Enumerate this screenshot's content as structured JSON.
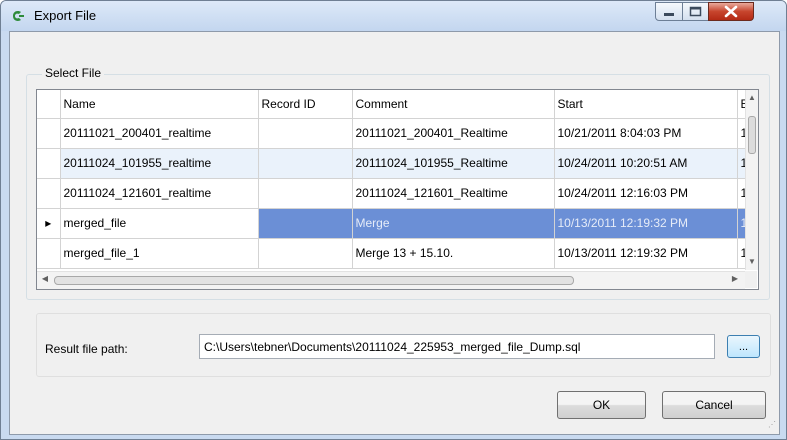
{
  "window": {
    "title": "Export File",
    "app_icon": "export-app-icon",
    "controls": {
      "minimize": "minimize-icon",
      "maximize": "maximize-icon",
      "close": "close-icon"
    }
  },
  "select_file": {
    "label": "Select File",
    "columns": [
      "Name",
      "Record ID",
      "Comment",
      "Start",
      "E"
    ],
    "rows": [
      {
        "name": "20111021_200401_realtime",
        "record_id": "",
        "comment": "20111021_200401_Realtime",
        "start": "10/21/2011 8:04:03 PM",
        "end": "1"
      },
      {
        "name": "20111024_101955_realtime",
        "record_id": "",
        "comment": "20111024_101955_Realtime",
        "start": "10/24/2011 10:20:51 AM",
        "end": "1"
      },
      {
        "name": "20111024_121601_realtime",
        "record_id": "",
        "comment": "20111024_121601_Realtime",
        "start": "10/24/2011 12:16:03 PM",
        "end": "1"
      },
      {
        "name": "merged_file",
        "record_id": "",
        "comment": "Merge",
        "start": "10/13/2011 12:19:32 PM",
        "end": "1"
      },
      {
        "name": "merged_file_1",
        "record_id": "",
        "comment": "Merge 13 + 15.10.",
        "start": "10/13/2011 12:19:32 PM",
        "end": "1"
      }
    ],
    "current_row_marker": "▸"
  },
  "result": {
    "label": "Result file path:",
    "path_value": "C:\\Users\\tebner\\Documents\\20111024_225953_merged_file_Dump.sql",
    "browse_label": "..."
  },
  "buttons": {
    "ok": "OK",
    "cancel": "Cancel"
  },
  "colors": {
    "selection": "#6b8fd6",
    "alt_row": "#eaf2fb",
    "title_bar": "#c9daf0"
  }
}
